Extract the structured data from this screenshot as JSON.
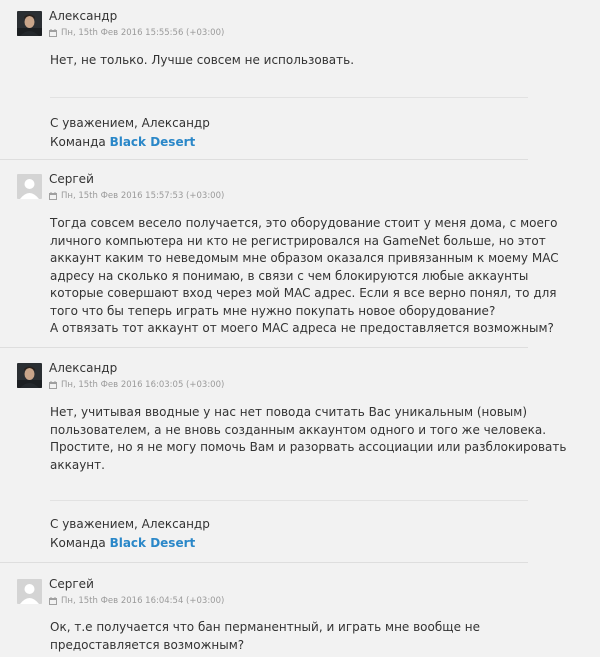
{
  "messages": [
    {
      "author": "Александр",
      "avatar": "user-photo-icon",
      "datetime": "Пн, 15th Фев 2016 15:55:56 (+03:00)",
      "lines": [
        "Нет, не только. Лучше совсем не использовать."
      ],
      "signature": {
        "greeting": "С уважением, Александр",
        "team_prefix": "Команда ",
        "team_name": "Black Desert"
      }
    },
    {
      "author": "Сергей",
      "avatar": "default-avatar-icon",
      "datetime": "Пн, 15th Фев 2016 15:57:53 (+03:00)",
      "lines": [
        "Тогда совсем весело получается, это оборудование стоит у меня дома, с моего",
        "личного компьютера ни кто не регистрировался на GameNet больше, но этот",
        "аккаунт каким то неведомым мне образом оказался привязанным к моему MAC",
        "адресу на сколько я понимаю, в связи с чем блокируются любые аккаунты",
        "которые совершают вход через мой MAC адрес. Если я все верно понял, то для",
        "того что бы теперь играть мне нужно покупать новое оборудование?",
        "А отвязать тот аккаунт от моего MAC адреса не предоставляется возможным?"
      ]
    },
    {
      "author": "Александр",
      "avatar": "user-photo-icon",
      "datetime": "Пн, 15th Фев 2016 16:03:05 (+03:00)",
      "lines": [
        "Нет, учитывая вводные у нас нет повода считать Вас уникальным (новым)",
        "пользователем, а не вновь созданным аккаунтом одного и того же человека.",
        "Простите, но я не могу помочь Вам и разорвать ассоциации или разблокировать",
        "аккаунт."
      ],
      "signature": {
        "greeting": "С уважением, Александр",
        "team_prefix": "Команда ",
        "team_name": "Black Desert"
      }
    },
    {
      "author": "Сергей",
      "avatar": "default-avatar-icon",
      "datetime": "Пн, 15th Фев 2016 16:04:54 (+03:00)",
      "lines": [
        "Ок, т.е получается что бан перманентный, и играть мне вообще не",
        "предоставляется возможным?"
      ]
    }
  ],
  "colors": {
    "background": "#f2f2f2",
    "link": "#2a87c8",
    "meta": "#9a9a9a",
    "text": "#333333"
  }
}
